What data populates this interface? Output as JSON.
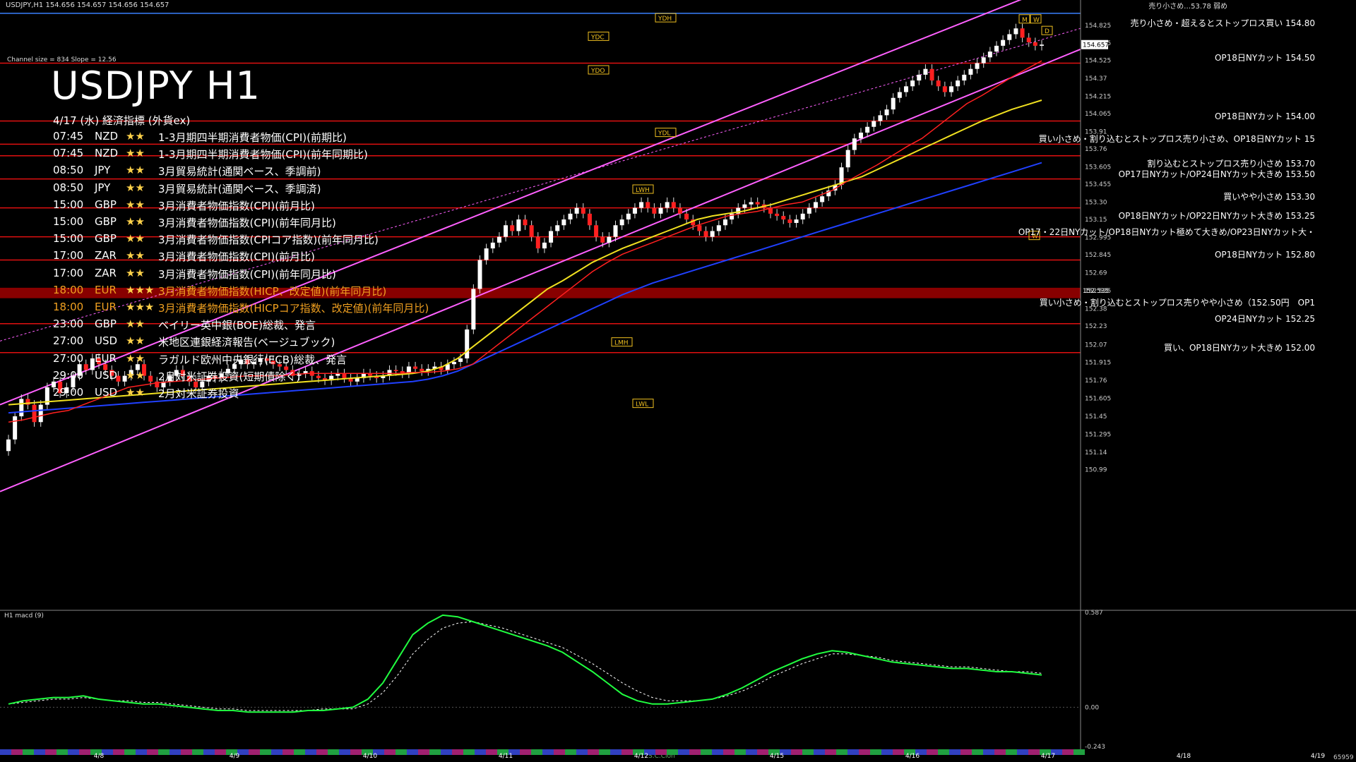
{
  "header": {
    "top_info": "USDJPY,H1  154.656 154.657 154.656 154.657",
    "channel_info": "Channel size = 834 Slope = 12.56",
    "title": "USDJPY H1",
    "calendar_title": "4/17 (水) 経済指標 (外貨ex)",
    "top_clip": "売り小さめ…53.78 弱め"
  },
  "calendar": [
    {
      "time": "07:45",
      "currency": "NZD",
      "stars": "★★",
      "event": "1-3月期四半期消費者物価(CPI)(前期比)",
      "color": "#ffffff"
    },
    {
      "time": "07:45",
      "currency": "NZD",
      "stars": "★★",
      "event": "1-3月期四半期消費者物価(CPI)(前年同期比)",
      "color": "#ffffff"
    },
    {
      "time": "08:50",
      "currency": "JPY",
      "stars": "★★",
      "event": "3月貿易統計(通関ベース、季調前)",
      "color": "#ffffff"
    },
    {
      "time": "08:50",
      "currency": "JPY",
      "stars": "★★",
      "event": "3月貿易統計(通関ベース、季調済)",
      "color": "#ffffff"
    },
    {
      "time": "15:00",
      "currency": "GBP",
      "stars": "★★",
      "event": "3月消費者物価指数(CPI)(前月比)",
      "color": "#ffffff"
    },
    {
      "time": "15:00",
      "currency": "GBP",
      "stars": "★★",
      "event": "3月消費者物価指数(CPI)(前年同月比)",
      "color": "#ffffff"
    },
    {
      "time": "15:00",
      "currency": "GBP",
      "stars": "★★",
      "event": "3月消費者物価指数(CPIコア指数)(前年同月比)",
      "color": "#ffffff"
    },
    {
      "time": "17:00",
      "currency": "ZAR",
      "stars": "★★",
      "event": "3月消費者物価指数(CPI)(前月比)",
      "color": "#ffffff"
    },
    {
      "time": "17:00",
      "currency": "ZAR",
      "stars": "★★",
      "event": "3月消費者物価指数(CPI)(前年同月比)",
      "color": "#ffffff"
    },
    {
      "time": "18:00",
      "currency": "EUR",
      "stars": "★★★",
      "event": "3月消費者物価指数(HICP、改定値)(前年同月比)",
      "color": "#f0a020"
    },
    {
      "time": "18:00",
      "currency": "EUR",
      "stars": "★★★",
      "event": "3月消費者物価指数(HICPコア指数、改定値)(前年同月比)",
      "color": "#f0a020"
    },
    {
      "time": "23:00",
      "currency": "GBP",
      "stars": "★★",
      "event": "ベイリー英中銀(BOE)総裁、発言",
      "color": "#ffffff"
    },
    {
      "time": "27:00",
      "currency": "USD",
      "stars": "★★",
      "event": "米地区連銀経済報告(ベージュブック)",
      "color": "#ffffff"
    },
    {
      "time": "27:00",
      "currency": "EUR",
      "stars": "★★",
      "event": "ラガルド欧州中央銀行(ECB)総裁、発言",
      "color": "#ffffff"
    },
    {
      "time": "29:00",
      "currency": "USD",
      "stars": "★★",
      "event": "2月対米証券投資(短期債除く)",
      "color": "#ffffff"
    },
    {
      "time": "29:00",
      "currency": "USD",
      "stars": "★★",
      "event": "2月対米証券投資",
      "color": "#ffffff"
    }
  ],
  "notes": [
    {
      "text": "売り小さめ・超えるとストップロス買い 154.80",
      "price": 154.8,
      "up": 1
    },
    {
      "text": "OP18日NYカット 154.50",
      "price": 154.5,
      "up": 1
    },
    {
      "text": "OP18日NYカット 154.00",
      "price": 154.0,
      "up": 1
    },
    {
      "text": "買い小さめ・割り込むとストップロス売り小さめ、OP18日NYカット 15",
      "price": 153.8,
      "up": 1
    },
    {
      "text": "割り込むとストップロス売り小さめ 153.70",
      "price": 153.7,
      "up": 0
    },
    {
      "text": "OP17日NYカット/OP24日NYカット大きめ 153.50",
      "price": 153.5,
      "up": 1
    },
    {
      "text": "買いやや小さめ 153.30",
      "price": 153.3,
      "up": 1
    },
    {
      "text": "OP18日NYカット/OP22日NYカット大きめ 153.25",
      "price": 153.25,
      "up": 0
    },
    {
      "text": "OP17・22日NYカット/OP18日NYカット極めて大きめ/OP23日NYカット大・",
      "price": 153.0,
      "up": 1
    },
    {
      "text": "OP18日NYカット 152.80",
      "price": 152.8,
      "up": 1
    },
    {
      "text": "買い小さめ・割り込むとストップロス売りやや小さめ（152.50円　OP1",
      "price": 152.5,
      "up": 0
    },
    {
      "text": "OP24日NYカット 152.25",
      "price": 152.25,
      "up": 1
    },
    {
      "text": "買い、OP18日NYカット大きめ 152.00",
      "price": 152.0,
      "up": 1
    }
  ],
  "macd_label": "H1 macd (9)",
  "chart_data": {
    "type": "candlestick",
    "symbol": "USDJPY",
    "timeframe": "H1",
    "ylim": [
      150.78,
      154.96
    ],
    "price_ticks": [
      154.825,
      154.675,
      154.525,
      154.37,
      154.215,
      154.065,
      153.91,
      153.76,
      153.605,
      153.455,
      153.3,
      153.15,
      152.995,
      152.845,
      152.69,
      152.535,
      152.38,
      152.23,
      152.07,
      151.915,
      151.76,
      151.605,
      151.45,
      151.295,
      151.14,
      150.99
    ],
    "current_price": 154.657,
    "current_price_label": "154.657",
    "marked_price_label": "152.535",
    "date_labels": [
      "4/8",
      "4/9",
      "4/10",
      "4/11",
      "4/12",
      "4/15",
      "4/16",
      "4/17",
      "4/18",
      "4/19"
    ],
    "x_label_positions": [
      140,
      332,
      524,
      716,
      908,
      1100,
      1292,
      1484,
      1676,
      1866
    ],
    "level_lines": [
      154.5,
      154.0,
      153.8,
      153.7,
      153.5,
      153.25,
      153.0,
      152.8,
      152.25,
      152.0
    ],
    "marker_labels": [
      "YDH",
      "YDC",
      "YDO",
      "YDL",
      "LWH",
      "LWL",
      "LMH",
      "M",
      "W",
      "D",
      "W"
    ],
    "macd": {
      "ylim": [
        -0.243,
        0.587
      ],
      "ticks": [
        0.587,
        0.0,
        -0.243
      ],
      "tick_labels": [
        "0.587",
        "0.00",
        "-0.243"
      ]
    },
    "macd_footer": "S.C.Cloh",
    "right_footer": "65959",
    "closes": [
      151.25,
      151.45,
      151.6,
      151.55,
      151.4,
      151.55,
      151.7,
      151.75,
      151.65,
      151.7,
      151.8,
      151.9,
      151.85,
      151.95,
      151.9,
      151.85,
      151.8,
      151.75,
      151.8,
      151.85,
      151.9,
      151.8,
      151.75,
      151.7,
      151.75,
      151.8,
      151.85,
      151.8,
      151.75,
      151.7,
      151.75,
      151.8,
      151.78,
      151.82,
      151.86,
      151.9,
      151.94,
      151.9,
      151.92,
      151.95,
      151.93,
      151.9,
      151.88,
      151.85,
      151.8,
      151.82,
      151.84,
      151.8,
      151.78,
      151.76,
      151.8,
      151.82,
      151.78,
      151.75,
      151.78,
      151.82,
      151.8,
      151.78,
      151.8,
      151.85,
      151.84,
      151.82,
      151.88,
      151.86,
      151.84,
      151.86,
      151.88,
      151.85,
      151.9,
      151.92,
      151.95,
      152.2,
      152.55,
      152.8,
      152.9,
      152.95,
      153.0,
      153.1,
      153.05,
      153.15,
      153.1,
      153.0,
      152.9,
      152.95,
      153.05,
      153.1,
      153.15,
      153.2,
      153.25,
      153.2,
      153.1,
      153.0,
      152.95,
      153.0,
      153.1,
      153.15,
      153.2,
      153.25,
      153.3,
      153.25,
      153.2,
      153.25,
      153.3,
      153.25,
      153.2,
      153.15,
      153.1,
      153.05,
      153.0,
      153.05,
      153.1,
      153.15,
      153.2,
      153.25,
      153.28,
      153.3,
      153.28,
      153.25,
      153.2,
      153.18,
      153.15,
      153.12,
      153.15,
      153.2,
      153.25,
      153.3,
      153.35,
      153.4,
      153.45,
      153.6,
      153.75,
      153.85,
      153.9,
      153.95,
      154.0,
      154.05,
      154.1,
      154.2,
      154.25,
      154.3,
      154.35,
      154.4,
      154.45,
      154.35,
      154.3,
      154.25,
      154.3,
      154.35,
      154.4,
      154.45,
      154.5,
      154.55,
      154.6,
      154.65,
      154.7,
      154.75,
      154.8,
      154.72,
      154.68,
      154.65,
      154.66
    ],
    "ma_short": [
      151.4,
      151.42,
      151.45,
      151.48,
      151.5,
      151.55,
      151.6,
      151.65,
      151.7,
      151.72,
      151.74,
      151.75,
      151.76,
      151.77,
      151.78,
      151.79,
      151.8,
      151.8,
      151.8,
      151.81,
      151.82,
      151.82,
      151.82,
      151.82,
      151.82,
      151.82,
      151.82,
      151.83,
      151.83,
      151.84,
      151.86,
      151.9,
      152.0,
      152.1,
      152.2,
      152.3,
      152.4,
      152.5,
      152.6,
      152.7,
      152.78,
      152.85,
      152.9,
      152.95,
      153.0,
      153.05,
      153.1,
      153.14,
      153.18,
      153.2,
      153.22,
      153.25,
      153.28,
      153.3,
      153.35,
      153.4,
      153.48,
      153.55,
      153.62,
      153.7,
      153.78,
      153.85,
      153.95,
      154.05,
      154.15,
      154.22,
      154.3,
      154.38,
      154.45,
      154.52
    ],
    "ma_mid": [
      151.55,
      151.56,
      151.57,
      151.58,
      151.59,
      151.6,
      151.61,
      151.62,
      151.63,
      151.64,
      151.65,
      151.66,
      151.67,
      151.68,
      151.69,
      151.7,
      151.71,
      151.72,
      151.73,
      151.74,
      151.75,
      151.76,
      151.77,
      151.78,
      151.79,
      151.8,
      151.81,
      151.82,
      151.84,
      151.88,
      151.95,
      152.05,
      152.15,
      152.25,
      152.35,
      152.45,
      152.55,
      152.62,
      152.7,
      152.78,
      152.84,
      152.9,
      152.95,
      153.0,
      153.05,
      153.1,
      153.15,
      153.18,
      153.2,
      153.22,
      153.25,
      153.28,
      153.32,
      153.36,
      153.4,
      153.44,
      153.48,
      153.52,
      153.58,
      153.64,
      153.7,
      153.76,
      153.82,
      153.88,
      153.94,
      154.0,
      154.05,
      154.1,
      154.14,
      154.18
    ],
    "ma_long": [
      151.48,
      151.49,
      151.5,
      151.51,
      151.52,
      151.53,
      151.54,
      151.55,
      151.56,
      151.57,
      151.58,
      151.59,
      151.6,
      151.61,
      151.62,
      151.63,
      151.64,
      151.65,
      151.66,
      151.67,
      151.68,
      151.69,
      151.7,
      151.71,
      151.72,
      151.73,
      151.74,
      151.75,
      151.77,
      151.8,
      151.84,
      151.9,
      151.96,
      152.02,
      152.08,
      152.14,
      152.2,
      152.26,
      152.32,
      152.38,
      152.44,
      152.5,
      152.55,
      152.6,
      152.64,
      152.68,
      152.72,
      152.76,
      152.8,
      152.84,
      152.88,
      152.92,
      152.96,
      153.0,
      153.04,
      153.08,
      153.12,
      153.16,
      153.2,
      153.24,
      153.28,
      153.32,
      153.36,
      153.4,
      153.44,
      153.48,
      153.52,
      153.56,
      153.6,
      153.64
    ],
    "macd_line": [
      0.02,
      0.04,
      0.05,
      0.06,
      0.06,
      0.07,
      0.05,
      0.04,
      0.03,
      0.02,
      0.02,
      0.01,
      0.0,
      -0.01,
      -0.02,
      -0.02,
      -0.03,
      -0.03,
      -0.03,
      -0.03,
      -0.02,
      -0.02,
      -0.01,
      0.0,
      0.05,
      0.15,
      0.3,
      0.45,
      0.52,
      0.57,
      0.56,
      0.53,
      0.5,
      0.47,
      0.44,
      0.41,
      0.38,
      0.34,
      0.28,
      0.22,
      0.15,
      0.08,
      0.04,
      0.02,
      0.02,
      0.03,
      0.04,
      0.05,
      0.08,
      0.12,
      0.17,
      0.22,
      0.26,
      0.3,
      0.33,
      0.35,
      0.34,
      0.32,
      0.3,
      0.28,
      0.27,
      0.26,
      0.25,
      0.24,
      0.24,
      0.23,
      0.22,
      0.22,
      0.21,
      0.2
    ],
    "macd_signal": [
      0.02,
      0.03,
      0.04,
      0.05,
      0.05,
      0.06,
      0.05,
      0.04,
      0.04,
      0.03,
      0.03,
      0.02,
      0.01,
      0.0,
      -0.01,
      -0.01,
      -0.02,
      -0.02,
      -0.02,
      -0.02,
      -0.02,
      -0.01,
      -0.01,
      -0.01,
      0.02,
      0.09,
      0.2,
      0.33,
      0.42,
      0.49,
      0.52,
      0.53,
      0.51,
      0.49,
      0.46,
      0.43,
      0.4,
      0.37,
      0.32,
      0.27,
      0.21,
      0.15,
      0.1,
      0.06,
      0.04,
      0.04,
      0.04,
      0.05,
      0.07,
      0.1,
      0.14,
      0.19,
      0.23,
      0.27,
      0.3,
      0.33,
      0.33,
      0.32,
      0.31,
      0.29,
      0.28,
      0.27,
      0.26,
      0.25,
      0.25,
      0.24,
      0.23,
      0.22,
      0.22,
      0.21
    ]
  }
}
